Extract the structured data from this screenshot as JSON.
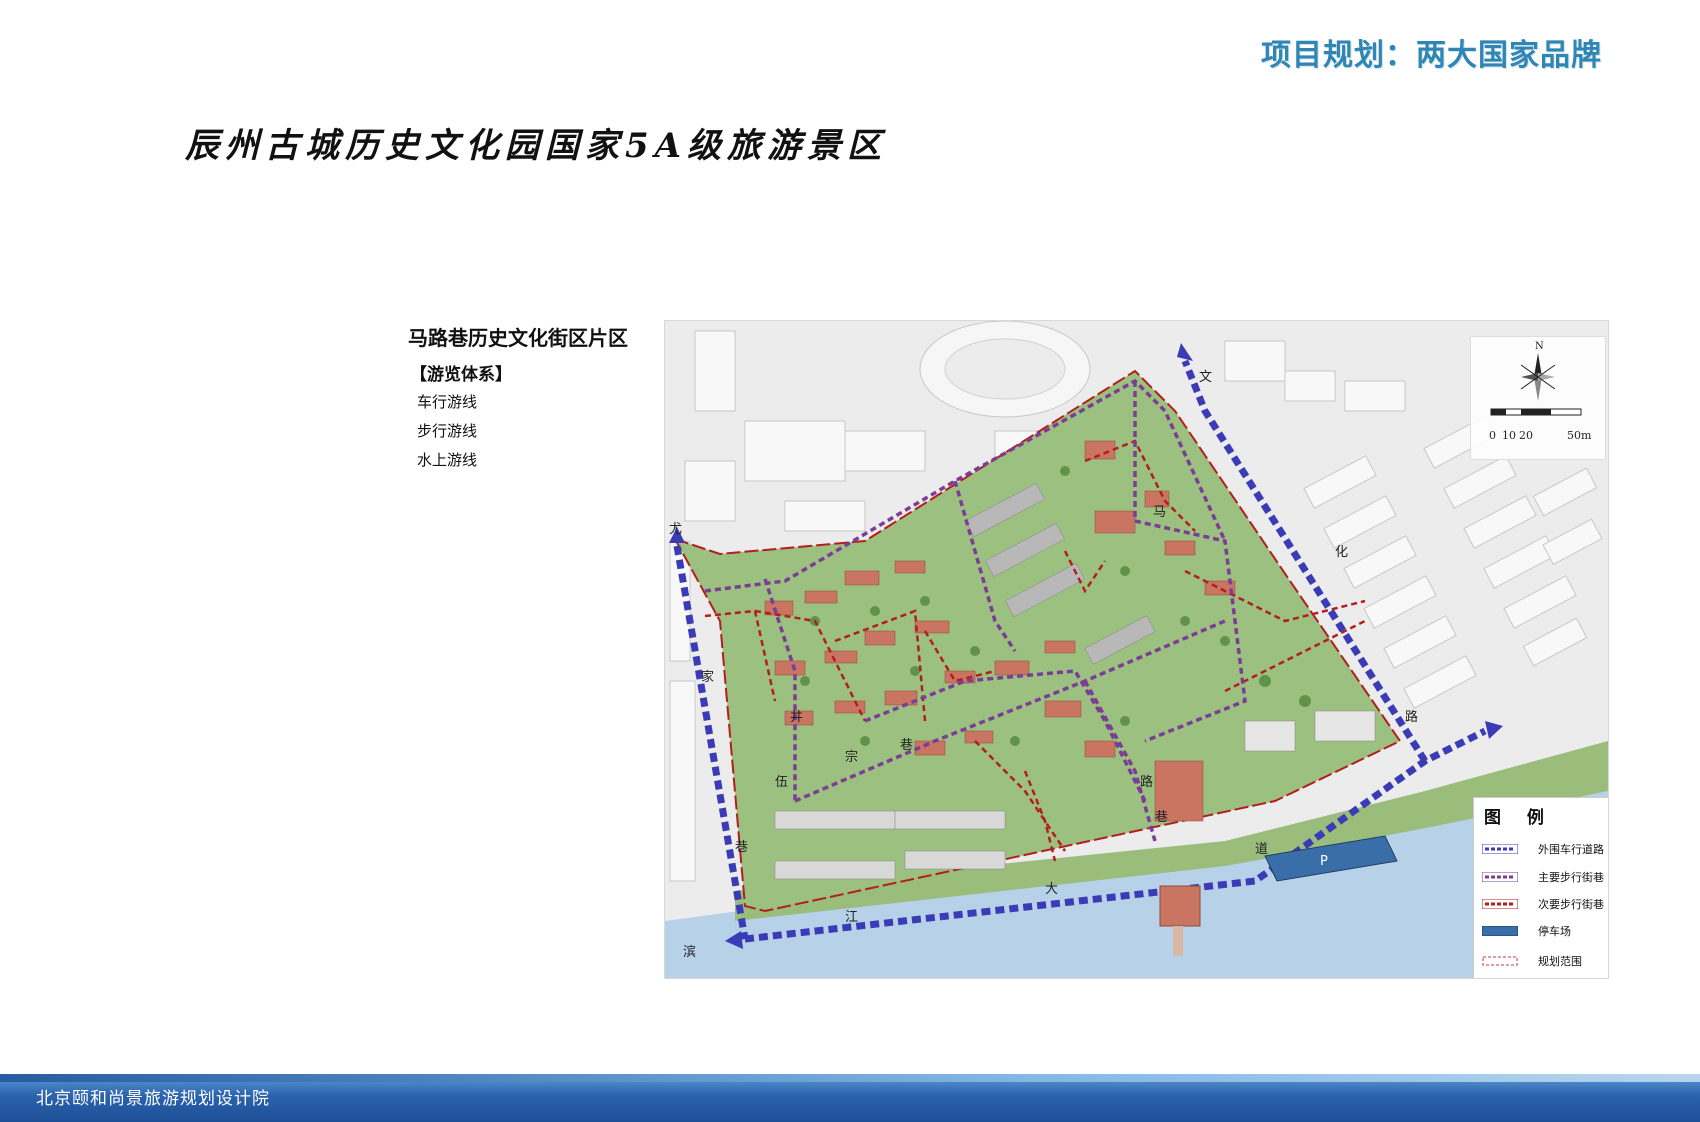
{
  "header": {
    "title": "项目规划：两大国家品牌"
  },
  "page": {
    "title": "辰州古城历史文化园国家5A级旅游景区"
  },
  "section": {
    "title": "马路巷历史文化街区片区",
    "subtitle": "【游览体系】",
    "routes": [
      "车行游线",
      "步行游线",
      "水上游线"
    ]
  },
  "map": {
    "compass_label": "N",
    "scale_labels": [
      "0",
      "10",
      "20",
      "50m"
    ],
    "road_labels": [
      "尤",
      "家",
      "巷",
      "滨",
      "江",
      "大",
      "道",
      "文",
      "化",
      "路",
      "马",
      "路",
      "巷",
      "井",
      "伍",
      "宗",
      "巷"
    ],
    "parking_label": "P",
    "legend": {
      "title": "图 例",
      "items": [
        {
          "label": "外围车行道路",
          "color": "#3b3bb8",
          "style": "outer-road"
        },
        {
          "label": "主要步行街巷",
          "color": "#7b3d96",
          "style": "main-walk"
        },
        {
          "label": "次要步行街巷",
          "color": "#b31e1e",
          "style": "minor-walk"
        },
        {
          "label": "停车场",
          "color": "#3a6ea8",
          "style": "parking"
        },
        {
          "label": "规划范围",
          "color": "#c23b3b",
          "style": "boundary"
        }
      ]
    },
    "colors": {
      "outer_road": "#3b3bb8",
      "main_walk": "#7b3d96",
      "minor_walk": "#b31e1e",
      "green": "#8db578",
      "roof": "#c46a5a",
      "water": "#b7d2e8"
    }
  },
  "footer": {
    "text": "北京颐和尚景旅游规划设计院"
  }
}
